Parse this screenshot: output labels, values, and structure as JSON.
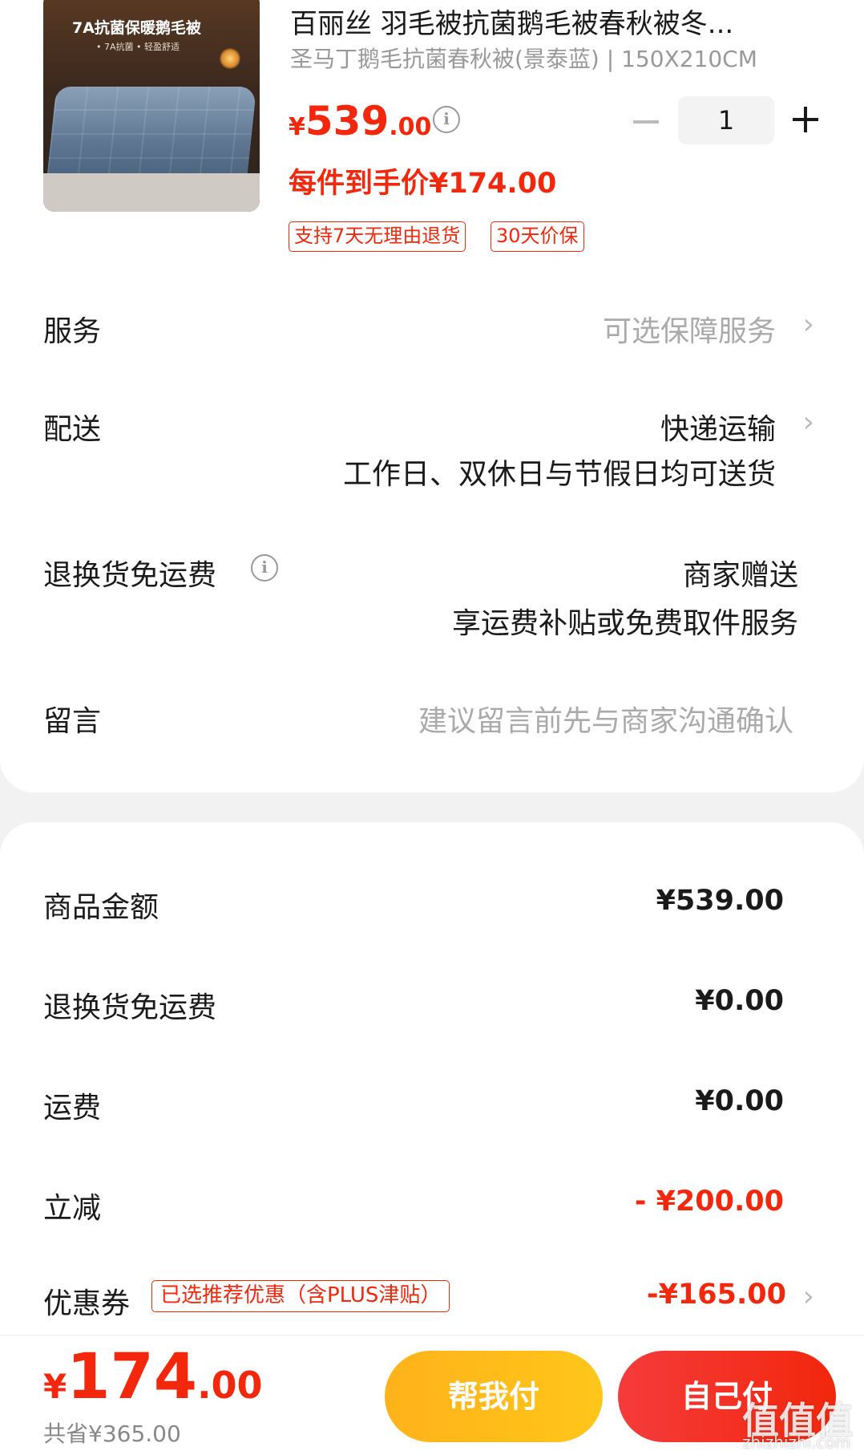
{
  "product": {
    "image_headline": "7A抗菌保暖鹅毛被",
    "image_sub": "• 7A抗菌    • 轻盈舒适",
    "title": "百丽丝 羽毛被抗菌鹅毛被春秋被冬...",
    "spec": "圣马丁鹅毛抗菌春秋被(景泰蓝) | 150X210CM",
    "price_symbol": "¥",
    "price_int": "539",
    "price_dec": ".00",
    "per_item_price": "每件到手价¥174.00",
    "tags": [
      "支持7天无理由退货",
      "30天价保"
    ],
    "quantity": "1"
  },
  "rows": {
    "service_label": "服务",
    "service_value": "可选保障服务",
    "delivery_label": "配送",
    "delivery_value": "快递运输",
    "delivery_note": "工作日、双休日与节假日均可送货",
    "return_label": "退换货免运费",
    "return_value": "商家赠送",
    "return_note": "享运费补贴或免费取件服务",
    "message_label": "留言",
    "message_placeholder": "建议留言前先与商家沟通确认"
  },
  "summary": {
    "goods_label": "商品金额",
    "goods_value": "¥539.00",
    "return_fee_label": "退换货免运费",
    "return_fee_value": "¥0.00",
    "shipping_label": "运费",
    "shipping_value": "¥0.00",
    "discount_label": "立减",
    "discount_value": "- ¥200.00",
    "coupon_label": "优惠券",
    "coupon_tag": "已选推荐优惠（含PLUS津贴）",
    "coupon_value": "-¥165.00"
  },
  "footer": {
    "total_symbol": "¥",
    "total_int": "174",
    "total_dec": ".00",
    "saved": "共省¥365.00",
    "help_pay": "帮我付",
    "self_pay": "自己付",
    "watermark": "值值值",
    "watermark_sub": "zhizhizhi.com"
  },
  "colors": {
    "accent": "#f2270c",
    "help_button": "#ffb21a",
    "self_button": "#f2270c"
  }
}
